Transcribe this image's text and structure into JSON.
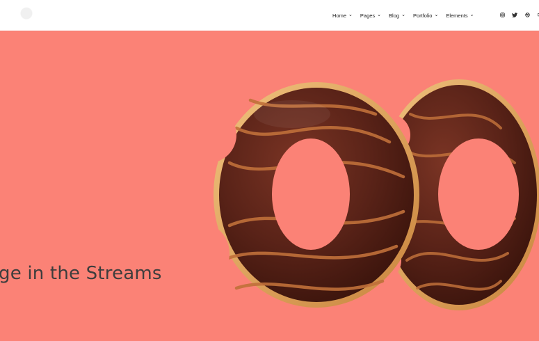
{
  "header": {
    "nav": [
      {
        "label": "Home",
        "icon": "chevron-down-icon"
      },
      {
        "label": "Pages",
        "icon": "chevron-down-icon"
      },
      {
        "label": "Blog",
        "icon": "chevron-down-icon"
      },
      {
        "label": "Portfolio",
        "icon": "chevron-down-icon"
      },
      {
        "label": "Elements",
        "icon": "chevron-down-icon"
      }
    ],
    "social": [
      "instagram-icon",
      "twitter-icon",
      "dribbble-icon",
      "behance-icon"
    ]
  },
  "hero": {
    "title": "ge in the Streams",
    "background": "#fb8276"
  },
  "colors": {
    "accent": "#fb8276",
    "chocolate": "#5a2318",
    "dough": "#d99a4e"
  }
}
